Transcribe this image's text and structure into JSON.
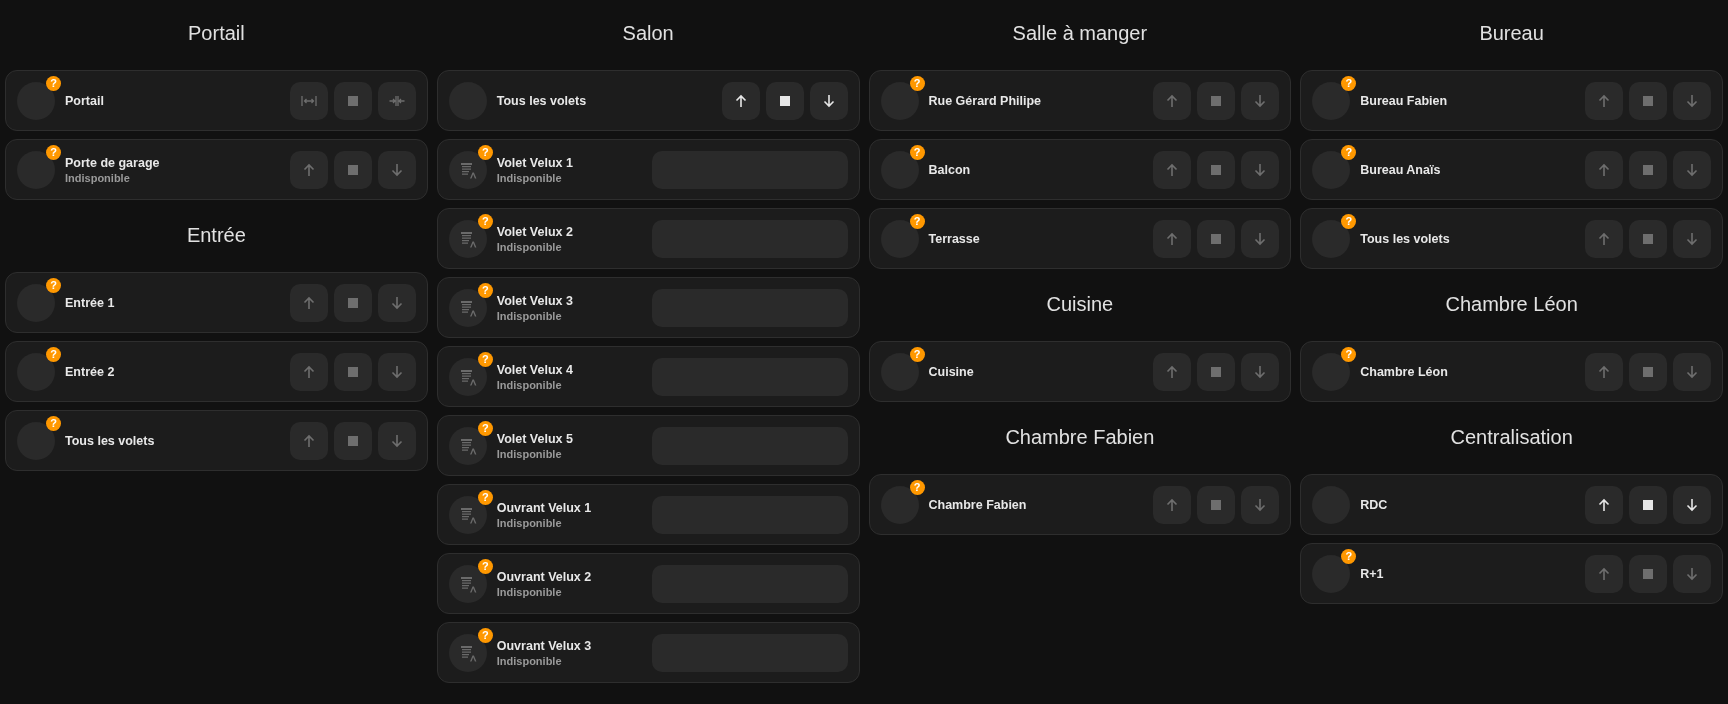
{
  "columns": [
    {
      "sections": [
        {
          "title": "Portail",
          "cards": [
            {
              "kind": "gate",
              "name": "Portail",
              "badge": "?",
              "disabled": true
            },
            {
              "kind": "cover",
              "name": "Porte de garage",
              "status": "Indisponible",
              "badge": "?",
              "disabled": true
            }
          ]
        },
        {
          "title": "Entrée",
          "cards": [
            {
              "kind": "cover",
              "name": "Entrée 1",
              "badge": "?",
              "disabled": true
            },
            {
              "kind": "cover",
              "name": "Entrée 2",
              "badge": "?",
              "disabled": true
            },
            {
              "kind": "cover",
              "name": "Tous les volets",
              "badge": "?",
              "disabled": true
            }
          ]
        }
      ]
    },
    {
      "sections": [
        {
          "title": "Salon",
          "cards": [
            {
              "kind": "cover",
              "name": "Tous les volets",
              "disabled": false
            },
            {
              "kind": "velux",
              "name": "Volet Velux 1",
              "status": "Indisponible",
              "badge": "?"
            },
            {
              "kind": "velux",
              "name": "Volet Velux 2",
              "status": "Indisponible",
              "badge": "?"
            },
            {
              "kind": "velux",
              "name": "Volet Velux 3",
              "status": "Indisponible",
              "badge": "?"
            },
            {
              "kind": "velux",
              "name": "Volet Velux 4",
              "status": "Indisponible",
              "badge": "?"
            },
            {
              "kind": "velux",
              "name": "Volet Velux 5",
              "status": "Indisponible",
              "badge": "?"
            },
            {
              "kind": "velux",
              "name": "Ouvrant Velux 1",
              "status": "Indisponible",
              "badge": "?"
            },
            {
              "kind": "velux",
              "name": "Ouvrant Velux 2",
              "status": "Indisponible",
              "badge": "?"
            },
            {
              "kind": "velux",
              "name": "Ouvrant Velux 3",
              "status": "Indisponible",
              "badge": "?"
            }
          ]
        }
      ]
    },
    {
      "sections": [
        {
          "title": "Salle à manger",
          "cards": [
            {
              "kind": "cover",
              "name": "Rue Gérard Philipe",
              "badge": "?",
              "disabled": true
            },
            {
              "kind": "cover",
              "name": "Balcon",
              "badge": "?",
              "disabled": true
            },
            {
              "kind": "cover",
              "name": "Terrasse",
              "badge": "?",
              "disabled": true
            }
          ]
        },
        {
          "title": "Cuisine",
          "cards": [
            {
              "kind": "cover",
              "name": "Cuisine",
              "badge": "?",
              "disabled": true
            }
          ]
        },
        {
          "title": "Chambre Fabien",
          "cards": [
            {
              "kind": "cover",
              "name": "Chambre Fabien",
              "badge": "?",
              "disabled": true
            }
          ]
        }
      ]
    },
    {
      "sections": [
        {
          "title": "Bureau",
          "cards": [
            {
              "kind": "cover",
              "name": "Bureau Fabien",
              "badge": "?",
              "disabled": true
            },
            {
              "kind": "cover",
              "name": "Bureau Anaïs",
              "badge": "?",
              "disabled": true
            },
            {
              "kind": "cover",
              "name": "Tous les volets",
              "badge": "?",
              "disabled": true
            }
          ]
        },
        {
          "title": "Chambre Léon",
          "cards": [
            {
              "kind": "cover",
              "name": "Chambre Léon",
              "badge": "?",
              "disabled": true
            }
          ]
        },
        {
          "title": "Centralisation",
          "cards": [
            {
              "kind": "cover",
              "name": "RDC",
              "disabled": false
            },
            {
              "kind": "cover",
              "name": "R+1",
              "badge": "?",
              "disabled": true
            }
          ]
        }
      ]
    }
  ]
}
